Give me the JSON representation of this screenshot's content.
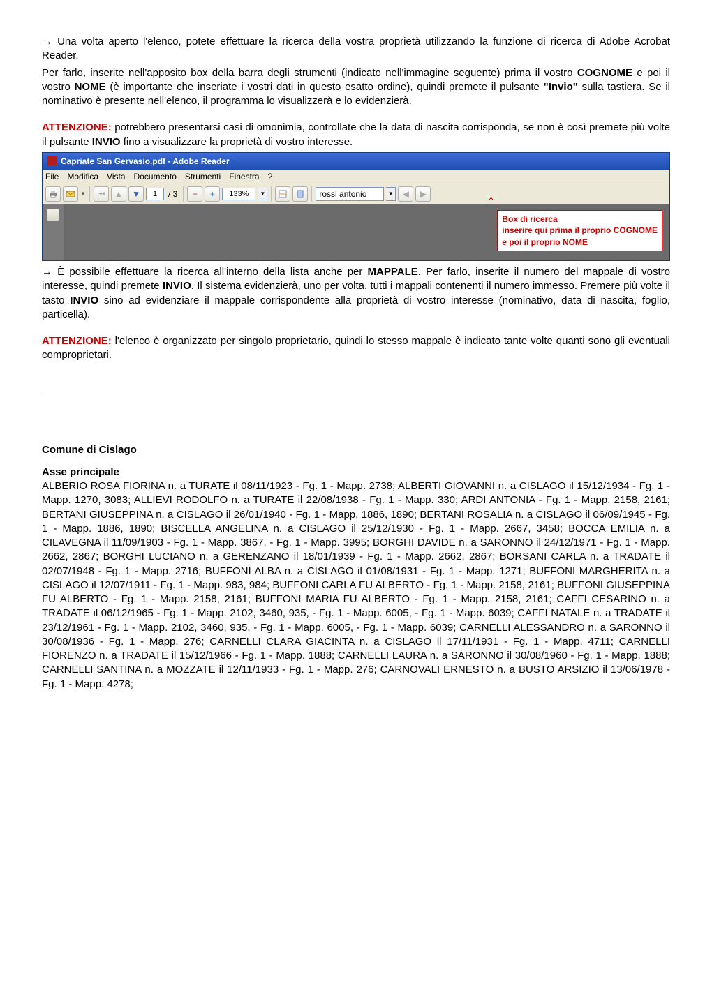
{
  "intro": {
    "arrow": "→",
    "p1": "Una volta aperto l'elenco, potete effettuare la ricerca della vostra proprietà utilizzando la funzione di ricerca di Adobe Acrobat Reader.",
    "p2a": "Per farlo, inserite nell'apposito box della barra degli strumenti (indicato nell'immagine seguente) prima il vostro ",
    "p2_cognome": "COGNOME",
    "p2b": " e poi il vostro ",
    "p2_nome": "NOME",
    "p2c": " (è importante che inseriate i vostri dati in questo esatto ordine), quindi premete il pulsante ",
    "p2_invio": "\"Invio\"",
    "p2d": " sulla tastiera. Se il nominativo è presente nell'elenco, il programma lo visualizzerà e lo evidenzierà."
  },
  "warn1": {
    "label": "ATTENZIONE:",
    "text_a": " potrebbero presentarsi casi di omonimia, controllate che la data di nascita corrisponda, se non è così premete più volte il pulsante ",
    "bold": "INVIO",
    "text_b": " fino a visualizzare la proprietà di vostro interesse."
  },
  "app": {
    "title": "Capriate San Gervasio.pdf - Adobe Reader",
    "menu": [
      "File",
      "Modifica",
      "Vista",
      "Documento",
      "Strumenti",
      "Finestra",
      "?"
    ],
    "page_current": "1",
    "page_total": "/ 3",
    "zoom": "133%",
    "search_value": "rossi antonio",
    "callout": {
      "line1": "Box di ricerca",
      "line2": "inserire qui prima il proprio COGNOME",
      "line3": "e poi il proprio NOME"
    }
  },
  "after_img": {
    "arrow": "→",
    "a": "È possibile effettuare la ricerca all'interno della lista anche per ",
    "mappale": "MAPPALE",
    "b": ". Per farlo, inserite il numero del mappale di vostro interesse, quindi premete ",
    "invio": "INVIO",
    "c": ". Il sistema evidenzierà, uno per volta, tutti i mappali contenenti il numero immesso.  Premere più volte il tasto ",
    "invio2": "INVIO",
    "d": " sino ad evidenziare il mappale corrispondente alla proprietà di vostro interesse (nominativo, data di nascita, foglio, particella)."
  },
  "warn2": {
    "label": "ATTENZIONE:",
    "text": " l'elenco è organizzato per singolo proprietario, quindi lo stesso mappale è indicato tante volte quanti sono gli eventuali comproprietari."
  },
  "comune": "Comune di Cislago",
  "asse": "Asse principale",
  "body": "ALBERIO ROSA FIORINA n. a TURATE il 08/11/1923 - Fg. 1 - Mapp. 2738; ALBERTI GIOVANNI n. a CISLAGO il 15/12/1934 - Fg. 1 - Mapp. 1270, 3083; ALLIEVI RODOLFO n. a TURATE il 22/08/1938 - Fg. 1 - Mapp. 330; ARDI ANTONIA - Fg. 1 - Mapp. 2158, 2161; BERTANI GIUSEPPINA n. a CISLAGO il 26/01/1940 - Fg. 1 - Mapp. 1886, 1890; BERTANI ROSALIA n. a CISLAGO il 06/09/1945 - Fg. 1 - Mapp. 1886, 1890; BISCELLA ANGELINA n. a CISLAGO il 25/12/1930 - Fg. 1 - Mapp. 2667, 3458; BOCCA EMILIA n. a CILAVEGNA il 11/09/1903 - Fg. 1 - Mapp. 3867, - Fg. 1 - Mapp. 3995; BORGHI DAVIDE n. a SARONNO il 24/12/1971 - Fg. 1 - Mapp. 2662, 2867; BORGHI LUCIANO n. a GERENZANO il 18/01/1939 - Fg. 1 - Mapp. 2662, 2867; BORSANI CARLA n. a TRADATE il 02/07/1948 - Fg. 1 - Mapp. 2716; BUFFONI ALBA n. a CISLAGO il 01/08/1931 - Fg. 1 - Mapp. 1271; BUFFONI MARGHERITA n. a CISLAGO il 12/07/1911 - Fg. 1 - Mapp. 983, 984; BUFFONI CARLA FU ALBERTO - Fg. 1 - Mapp. 2158, 2161; BUFFONI GIUSEPPINA FU ALBERTO - Fg. 1 - Mapp. 2158, 2161; BUFFONI MARIA FU ALBERTO - Fg. 1 - Mapp. 2158, 2161; CAFFI CESARINO n. a TRADATE il 06/12/1965 - Fg. 1 - Mapp. 2102, 3460, 935, - Fg. 1 - Mapp. 6005, - Fg. 1 - Mapp. 6039; CAFFI NATALE n. a TRADATE il 23/12/1961 - Fg. 1 - Mapp. 2102, 3460, 935, - Fg. 1 - Mapp. 6005, - Fg. 1 - Mapp. 6039; CARNELLI ALESSANDRO n. a SARONNO il 30/08/1936 - Fg. 1 - Mapp. 276; CARNELLI CLARA GIACINTA n. a CISLAGO il 17/11/1931 - Fg. 1 - Mapp. 4711; CARNELLI FIORENZO n. a TRADATE il 15/12/1966 - Fg. 1 - Mapp. 1888; CARNELLI LAURA n. a SARONNO il 30/08/1960 - Fg. 1 - Mapp. 1888; CARNELLI SANTINA n. a MOZZATE il 12/11/1933 - Fg. 1 - Mapp. 276; CARNOVALI ERNESTO n. a BUSTO ARSIZIO il 13/06/1978 - Fg. 1 - Mapp. 4278;"
}
